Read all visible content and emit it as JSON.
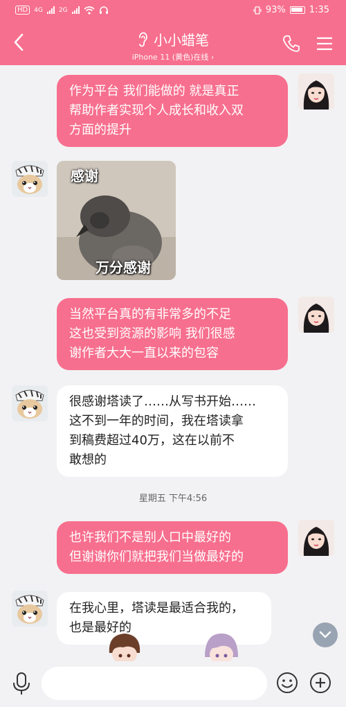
{
  "status_bar": {
    "hd_label": "HD",
    "sim1_label": "4G",
    "sim2_label": "2G",
    "battery": "93%",
    "time": "1:35"
  },
  "header": {
    "title": "小小蜡笔",
    "subtitle": "iPhone 11 (黄色)在线 ›"
  },
  "messages": [
    {
      "from": "me",
      "text": "作为平台 我们能做的 就是真正\n帮助作者实现个人成长和收入双\n方面的提升"
    },
    {
      "from": "them",
      "type": "sticker",
      "caption_top": "感谢",
      "caption_bottom": "万分感谢"
    },
    {
      "from": "me",
      "text": "当然平台真的有非常多的不足\n这也受到资源的影响 我们很感\n谢作者大大一直以来的包容"
    },
    {
      "from": "them",
      "text": "很感谢塔读了……从写书开始……\n这不到一年的时间，我在塔读拿\n到稿费超过40万，这在以前不\n敢想的"
    },
    {
      "type": "timestamp",
      "text": "星期五 下午4:56"
    },
    {
      "from": "me",
      "text": "也许我们不是别人口中最好的\n但谢谢你们就把我们当做最好的"
    },
    {
      "from": "them",
      "text": "在我心里，塔读是最适合我的，\n也是最好的"
    }
  ],
  "input": {
    "placeholder": ""
  },
  "icons": {
    "back": "back-arrow-icon",
    "ear": "ear-icon",
    "phone": "phone-icon",
    "menu": "menu-icon",
    "mic": "microphone-icon",
    "emoji": "emoji-icon",
    "plus": "plus-icon",
    "scroll": "chevron-down-icon"
  },
  "colors": {
    "brand_pink": "#f76f8e",
    "chat_bg": "#f2f2f4",
    "bubble_them": "#ffffff"
  }
}
